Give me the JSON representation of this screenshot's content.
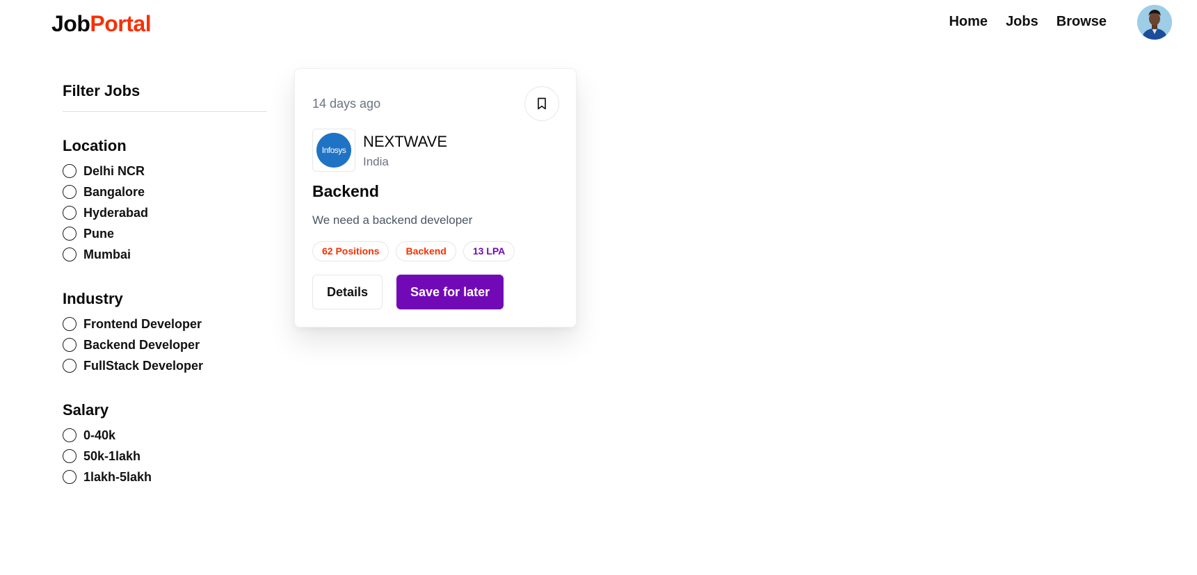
{
  "header": {
    "logo_part1": "Job",
    "logo_part2": "Portal",
    "nav": [
      "Home",
      "Jobs",
      "Browse"
    ]
  },
  "filter": {
    "title": "Filter Jobs",
    "groups": [
      {
        "title": "Location",
        "options": [
          "Delhi NCR",
          "Bangalore",
          "Hyderabad",
          "Pune",
          "Mumbai"
        ]
      },
      {
        "title": "Industry",
        "options": [
          "Frontend Developer",
          "Backend Developer",
          "FullStack Developer"
        ]
      },
      {
        "title": "Salary",
        "options": [
          "0-40k",
          "50k-1lakh",
          "1lakh-5lakh"
        ]
      }
    ]
  },
  "job": {
    "posted": "14 days ago",
    "company_logo_text": "Infosys",
    "company": "NEXTWAVE",
    "location": "India",
    "title": "Backend",
    "description": "We need a backend developer",
    "badges": {
      "positions": "62 Positions",
      "job_type": "Backend",
      "salary": "13 LPA"
    },
    "details_label": "Details",
    "save_label": "Save for later"
  },
  "colors": {
    "brand_red": "#F83002",
    "brand_purple": "#7209b7"
  }
}
